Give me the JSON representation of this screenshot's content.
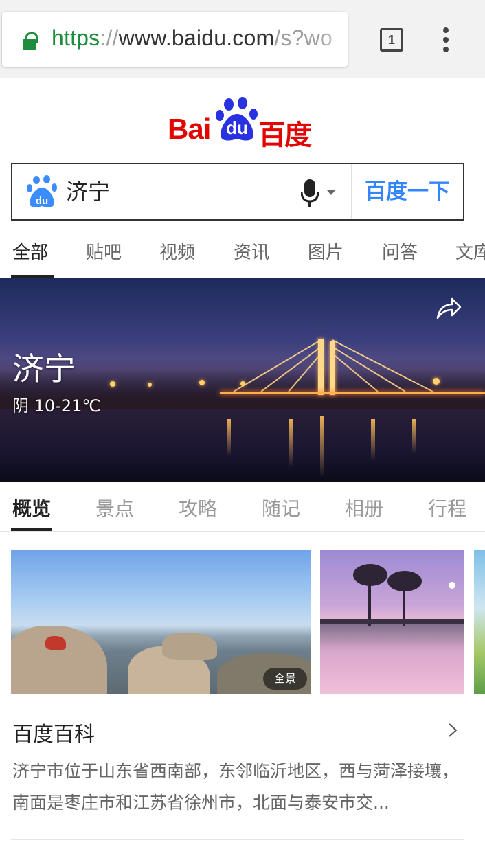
{
  "browser": {
    "url": {
      "scheme": "https",
      "separator": "://",
      "host": "www.baidu.com",
      "path": "/s?wo"
    },
    "tab_count": "1"
  },
  "logo": {
    "bai": "Bai",
    "du": "du",
    "cn": "百度"
  },
  "search": {
    "query": "济宁",
    "button_label": "百度一下"
  },
  "top_tabs": [
    {
      "label": "全部",
      "active": true
    },
    {
      "label": "贴吧"
    },
    {
      "label": "视频"
    },
    {
      "label": "资讯"
    },
    {
      "label": "图片"
    },
    {
      "label": "问答"
    },
    {
      "label": "文库"
    }
  ],
  "hero": {
    "title": "济宁",
    "weather": "阴 10-21℃"
  },
  "section_tabs": [
    {
      "label": "概览",
      "active": true
    },
    {
      "label": "景点"
    },
    {
      "label": "攻略"
    },
    {
      "label": "随记"
    },
    {
      "label": "相册"
    },
    {
      "label": "行程"
    }
  ],
  "images": {
    "pano_badge": "全景"
  },
  "baike": {
    "title": "百度百科",
    "summary": "济宁市位于山东省西南部，东邻临沂地区，西与菏泽接壤，南面是枣庄市和江苏省徐州市，北面与泰安市交..."
  },
  "colors": {
    "brand_red": "#e10601",
    "brand_blue": "#2932e1",
    "link_blue": "#3385ff",
    "secure_green": "#1e8e3e"
  }
}
